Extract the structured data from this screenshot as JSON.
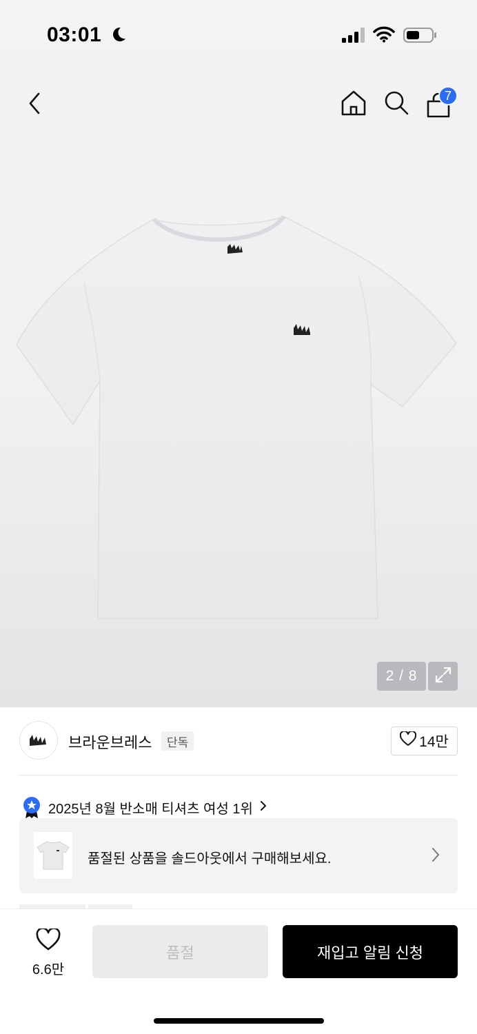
{
  "status_bar": {
    "time": "03:01",
    "icons": [
      "moon-icon",
      "signal-icon",
      "wifi-icon",
      "battery-icon"
    ]
  },
  "nav": {
    "icons": [
      "back-icon",
      "home-icon",
      "search-icon",
      "cart-icon"
    ],
    "cart_count": "7"
  },
  "gallery": {
    "counter": "2 / 8"
  },
  "brand": {
    "name": "브라운브레스",
    "tag": "단독",
    "like_count": "14만"
  },
  "ranking": {
    "text": "2025년 8월 반소매 티셔츠 여성 1위",
    "accent_color": "#2b6cf5"
  },
  "soldout_banner": {
    "text": "품절된 상품을 솔드아웃에서 구매해보세요."
  },
  "bottom": {
    "wish_count": "6.6만",
    "soldout_label": "품절",
    "restock_label": "재입고 알림 신청"
  }
}
